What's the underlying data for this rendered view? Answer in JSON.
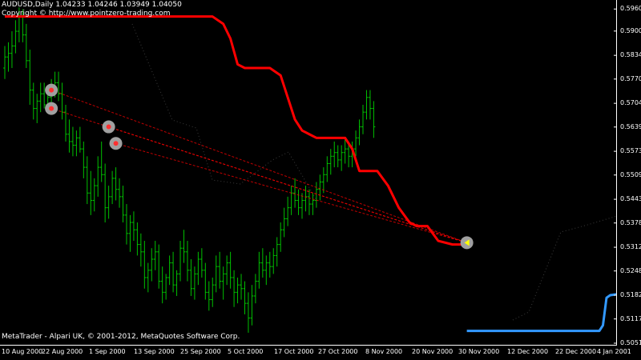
{
  "header": {
    "symbol_line": "AUDUSD,Daily  1.04233 1.04246 1.03949 1.04050",
    "copyright": "Copyright © http://www.pointzero-trading.com"
  },
  "footer": {
    "credit": "MetaTrader - Alpari UK, © 2001-2012, MetaQuotes Software Corp."
  },
  "price_axis": [
    "0.59605",
    "0.59005",
    "0.58345",
    "0.57700",
    "0.57040",
    "0.56395",
    "0.55735",
    "0.55090",
    "0.54430",
    "0.53785",
    "0.53125",
    "0.52480",
    "0.51820",
    "0.51175",
    "0.50515"
  ],
  "time_axis": [
    "10 Aug 2000",
    "22 Aug 2000",
    "1 Sep 2000",
    "13 Sep 2000",
    "25 Sep 2000",
    "5 Oct 2000",
    "17 Oct 2000",
    "27 Oct 2000",
    "8 Nov 2000",
    "20 Nov 2000",
    "30 Nov 2000",
    "12 Dec 2000",
    "22 Dec 2000",
    "4 Jan 2001"
  ],
  "colors": {
    "background": "#000000",
    "candles": "#00c000",
    "trailing_stop": "#ff0000",
    "support_line": "#3399ff",
    "signal_marker": "#a0a0a0",
    "grid": "#2a2a2a"
  },
  "chart_data": {
    "type": "bar",
    "title": "AUDUSD,Daily",
    "y_range": [
      0.5045,
      0.5985
    ],
    "ohlc": [
      [
        0.58,
        0.586,
        0.577,
        0.583
      ],
      [
        0.583,
        0.587,
        0.579,
        0.584
      ],
      [
        0.584,
        0.59,
        0.58,
        0.586
      ],
      [
        0.586,
        0.593,
        0.584,
        0.59
      ],
      [
        0.59,
        0.5965,
        0.587,
        0.594
      ],
      [
        0.594,
        0.596,
        0.587,
        0.589
      ],
      [
        0.589,
        0.592,
        0.58,
        0.582
      ],
      [
        0.582,
        0.585,
        0.57,
        0.574
      ],
      [
        0.574,
        0.576,
        0.566,
        0.569
      ],
      [
        0.569,
        0.573,
        0.565,
        0.571
      ],
      [
        0.571,
        0.576,
        0.568,
        0.573
      ],
      [
        0.573,
        0.576,
        0.569,
        0.57
      ],
      [
        0.57,
        0.574,
        0.568,
        0.572
      ],
      [
        0.572,
        0.577,
        0.57,
        0.575
      ],
      [
        0.575,
        0.579,
        0.572,
        0.576
      ],
      [
        0.576,
        0.579,
        0.571,
        0.573
      ],
      [
        0.573,
        0.576,
        0.566,
        0.568
      ],
      [
        0.568,
        0.57,
        0.56,
        0.562
      ],
      [
        0.562,
        0.566,
        0.557,
        0.56
      ],
      [
        0.56,
        0.564,
        0.556,
        0.559
      ],
      [
        0.559,
        0.563,
        0.556,
        0.561
      ],
      [
        0.561,
        0.564,
        0.557,
        0.558
      ],
      [
        0.558,
        0.56,
        0.55,
        0.553
      ],
      [
        0.553,
        0.556,
        0.543,
        0.546
      ],
      [
        0.546,
        0.552,
        0.54,
        0.544
      ],
      [
        0.544,
        0.55,
        0.541,
        0.548
      ],
      [
        0.548,
        0.556,
        0.545,
        0.553
      ],
      [
        0.553,
        0.56,
        0.549,
        0.551
      ],
      [
        0.551,
        0.554,
        0.538,
        0.542
      ],
      [
        0.542,
        0.548,
        0.539,
        0.545
      ],
      [
        0.545,
        0.552,
        0.543,
        0.55
      ],
      [
        0.55,
        0.553,
        0.544,
        0.547
      ],
      [
        0.547,
        0.55,
        0.542,
        0.545
      ],
      [
        0.545,
        0.548,
        0.538,
        0.54
      ],
      [
        0.54,
        0.543,
        0.532,
        0.535
      ],
      [
        0.535,
        0.54,
        0.53,
        0.538
      ],
      [
        0.538,
        0.541,
        0.533,
        0.536
      ],
      [
        0.536,
        0.538,
        0.529,
        0.532
      ],
      [
        0.532,
        0.535,
        0.526,
        0.53
      ],
      [
        0.53,
        0.533,
        0.52,
        0.523
      ],
      [
        0.523,
        0.527,
        0.519,
        0.525
      ],
      [
        0.525,
        0.531,
        0.522,
        0.528
      ],
      [
        0.528,
        0.533,
        0.525,
        0.53
      ],
      [
        0.53,
        0.532,
        0.52,
        0.522
      ],
      [
        0.522,
        0.526,
        0.516,
        0.519
      ],
      [
        0.519,
        0.524,
        0.517,
        0.523
      ],
      [
        0.523,
        0.529,
        0.521,
        0.527
      ],
      [
        0.527,
        0.53,
        0.519,
        0.521
      ],
      [
        0.521,
        0.525,
        0.518,
        0.524
      ],
      [
        0.524,
        0.533,
        0.522,
        0.531
      ],
      [
        0.531,
        0.536,
        0.527,
        0.53
      ],
      [
        0.53,
        0.533,
        0.522,
        0.525
      ],
      [
        0.525,
        0.528,
        0.518,
        0.52
      ],
      [
        0.52,
        0.526,
        0.517,
        0.524
      ],
      [
        0.524,
        0.53,
        0.521,
        0.528
      ],
      [
        0.528,
        0.531,
        0.523,
        0.525
      ],
      [
        0.525,
        0.527,
        0.517,
        0.519
      ],
      [
        0.519,
        0.522,
        0.514,
        0.517
      ],
      [
        0.517,
        0.523,
        0.515,
        0.521
      ],
      [
        0.521,
        0.529,
        0.519,
        0.526
      ],
      [
        0.526,
        0.53,
        0.52,
        0.522
      ],
      [
        0.522,
        0.526,
        0.517,
        0.524
      ],
      [
        0.524,
        0.529,
        0.521,
        0.527
      ],
      [
        0.527,
        0.53,
        0.52,
        0.523
      ],
      [
        0.523,
        0.525,
        0.515,
        0.519
      ],
      [
        0.519,
        0.523,
        0.516,
        0.521
      ],
      [
        0.521,
        0.524,
        0.517,
        0.52
      ],
      [
        0.52,
        0.522,
        0.513,
        0.516
      ],
      [
        0.516,
        0.519,
        0.508,
        0.512
      ],
      [
        0.512,
        0.521,
        0.51,
        0.518
      ],
      [
        0.518,
        0.524,
        0.516,
        0.522
      ],
      [
        0.522,
        0.53,
        0.52,
        0.527
      ],
      [
        0.527,
        0.531,
        0.523,
        0.525
      ],
      [
        0.525,
        0.529,
        0.521,
        0.527
      ],
      [
        0.527,
        0.53,
        0.523,
        0.526
      ],
      [
        0.526,
        0.531,
        0.524,
        0.529
      ],
      [
        0.529,
        0.534,
        0.526,
        0.532
      ],
      [
        0.532,
        0.538,
        0.53,
        0.536
      ],
      [
        0.536,
        0.542,
        0.534,
        0.539
      ],
      [
        0.539,
        0.545,
        0.537,
        0.542
      ],
      [
        0.542,
        0.548,
        0.54,
        0.546
      ],
      [
        0.546,
        0.55,
        0.542,
        0.544
      ],
      [
        0.544,
        0.547,
        0.54,
        0.542
      ],
      [
        0.542,
        0.546,
        0.539,
        0.544
      ],
      [
        0.544,
        0.548,
        0.541,
        0.545
      ],
      [
        0.545,
        0.547,
        0.54,
        0.543
      ],
      [
        0.543,
        0.546,
        0.54,
        0.544
      ],
      [
        0.544,
        0.549,
        0.542,
        0.547
      ],
      [
        0.547,
        0.551,
        0.544,
        0.549
      ],
      [
        0.549,
        0.553,
        0.546,
        0.551
      ],
      [
        0.551,
        0.556,
        0.549,
        0.554
      ],
      [
        0.554,
        0.558,
        0.551,
        0.556
      ],
      [
        0.556,
        0.56,
        0.553,
        0.557
      ],
      [
        0.557,
        0.559,
        0.553,
        0.555
      ],
      [
        0.555,
        0.559,
        0.552,
        0.557
      ],
      [
        0.557,
        0.561,
        0.554,
        0.558
      ],
      [
        0.558,
        0.56,
        0.553,
        0.556
      ],
      [
        0.556,
        0.56,
        0.553,
        0.558
      ],
      [
        0.558,
        0.563,
        0.556,
        0.561
      ],
      [
        0.561,
        0.566,
        0.559,
        0.564
      ],
      [
        0.564,
        0.57,
        0.562,
        0.568
      ],
      [
        0.568,
        0.574,
        0.566,
        0.572
      ],
      [
        0.572,
        0.574,
        0.566,
        0.569
      ],
      [
        0.569,
        0.571,
        0.561,
        0.564
      ]
    ],
    "trailing_stop": [
      [
        0,
        0.594
      ],
      [
        58,
        0.594
      ],
      [
        61,
        0.592
      ],
      [
        63,
        0.588
      ],
      [
        65,
        0.581
      ],
      [
        67,
        0.58
      ],
      [
        74,
        0.58
      ],
      [
        77,
        0.578
      ],
      [
        79,
        0.572
      ],
      [
        81,
        0.566
      ],
      [
        83,
        0.563
      ],
      [
        85,
        0.562
      ],
      [
        87,
        0.561
      ],
      [
        95,
        0.561
      ],
      [
        97,
        0.558
      ],
      [
        99,
        0.552
      ],
      [
        104,
        0.552
      ],
      [
        107,
        0.548
      ],
      [
        110,
        0.542
      ],
      [
        113,
        0.538
      ],
      [
        115,
        0.537
      ],
      [
        118,
        0.537
      ],
      [
        121,
        0.533
      ],
      [
        125,
        0.532
      ],
      [
        129,
        0.532
      ]
    ],
    "support_line": [
      [
        129,
        0.5085
      ],
      [
        166,
        0.5085
      ],
      [
        167,
        0.51
      ],
      [
        168,
        0.5175
      ],
      [
        169,
        0.5182
      ],
      [
        171,
        0.5185
      ]
    ],
    "signal_markers": [
      [
        13,
        0.574
      ],
      [
        13,
        0.569
      ],
      [
        29,
        0.564
      ],
      [
        31,
        0.5595
      ],
      [
        129,
        0.5325
      ]
    ],
    "signal_lines": [
      [
        [
          13,
          0.574
        ],
        [
          129,
          0.5325
        ]
      ],
      [
        [
          13,
          0.569
        ],
        [
          129,
          0.5325
        ]
      ],
      [
        [
          29,
          0.564
        ],
        [
          129,
          0.5325
        ]
      ],
      [
        [
          31,
          0.5595
        ],
        [
          129,
          0.5325
        ]
      ]
    ]
  }
}
